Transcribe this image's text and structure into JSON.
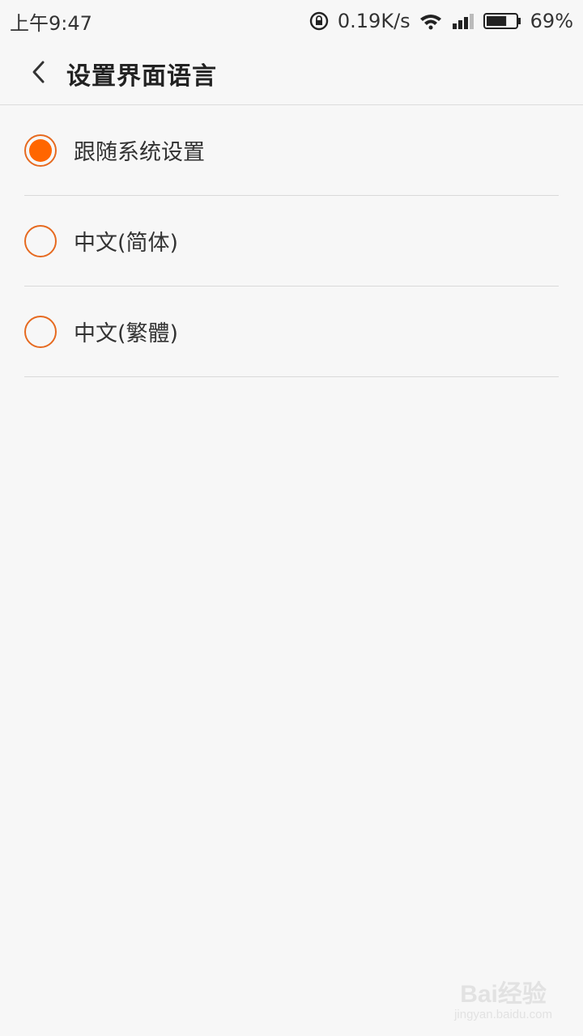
{
  "status_bar": {
    "time": "上午9:47",
    "network_speed": "0.19K/s",
    "battery_percent": "69%",
    "battery_level": 0.69,
    "icons": [
      "rotation-lock-icon",
      "wifi-icon",
      "signal-icon",
      "battery-icon"
    ]
  },
  "nav": {
    "back_icon": "back-arrow-icon",
    "title": "设置界面语言"
  },
  "options": [
    {
      "label": "跟随系统设置",
      "selected": true
    },
    {
      "label": "中文(简体)",
      "selected": false
    },
    {
      "label": "中文(繁體)",
      "selected": false
    }
  ],
  "watermark": {
    "main": "Bai经验",
    "sub": "jingyan.baidu.com"
  },
  "colors": {
    "accent": "#ff6600",
    "radio_border": "#e66a20",
    "background": "#f7f7f7"
  }
}
